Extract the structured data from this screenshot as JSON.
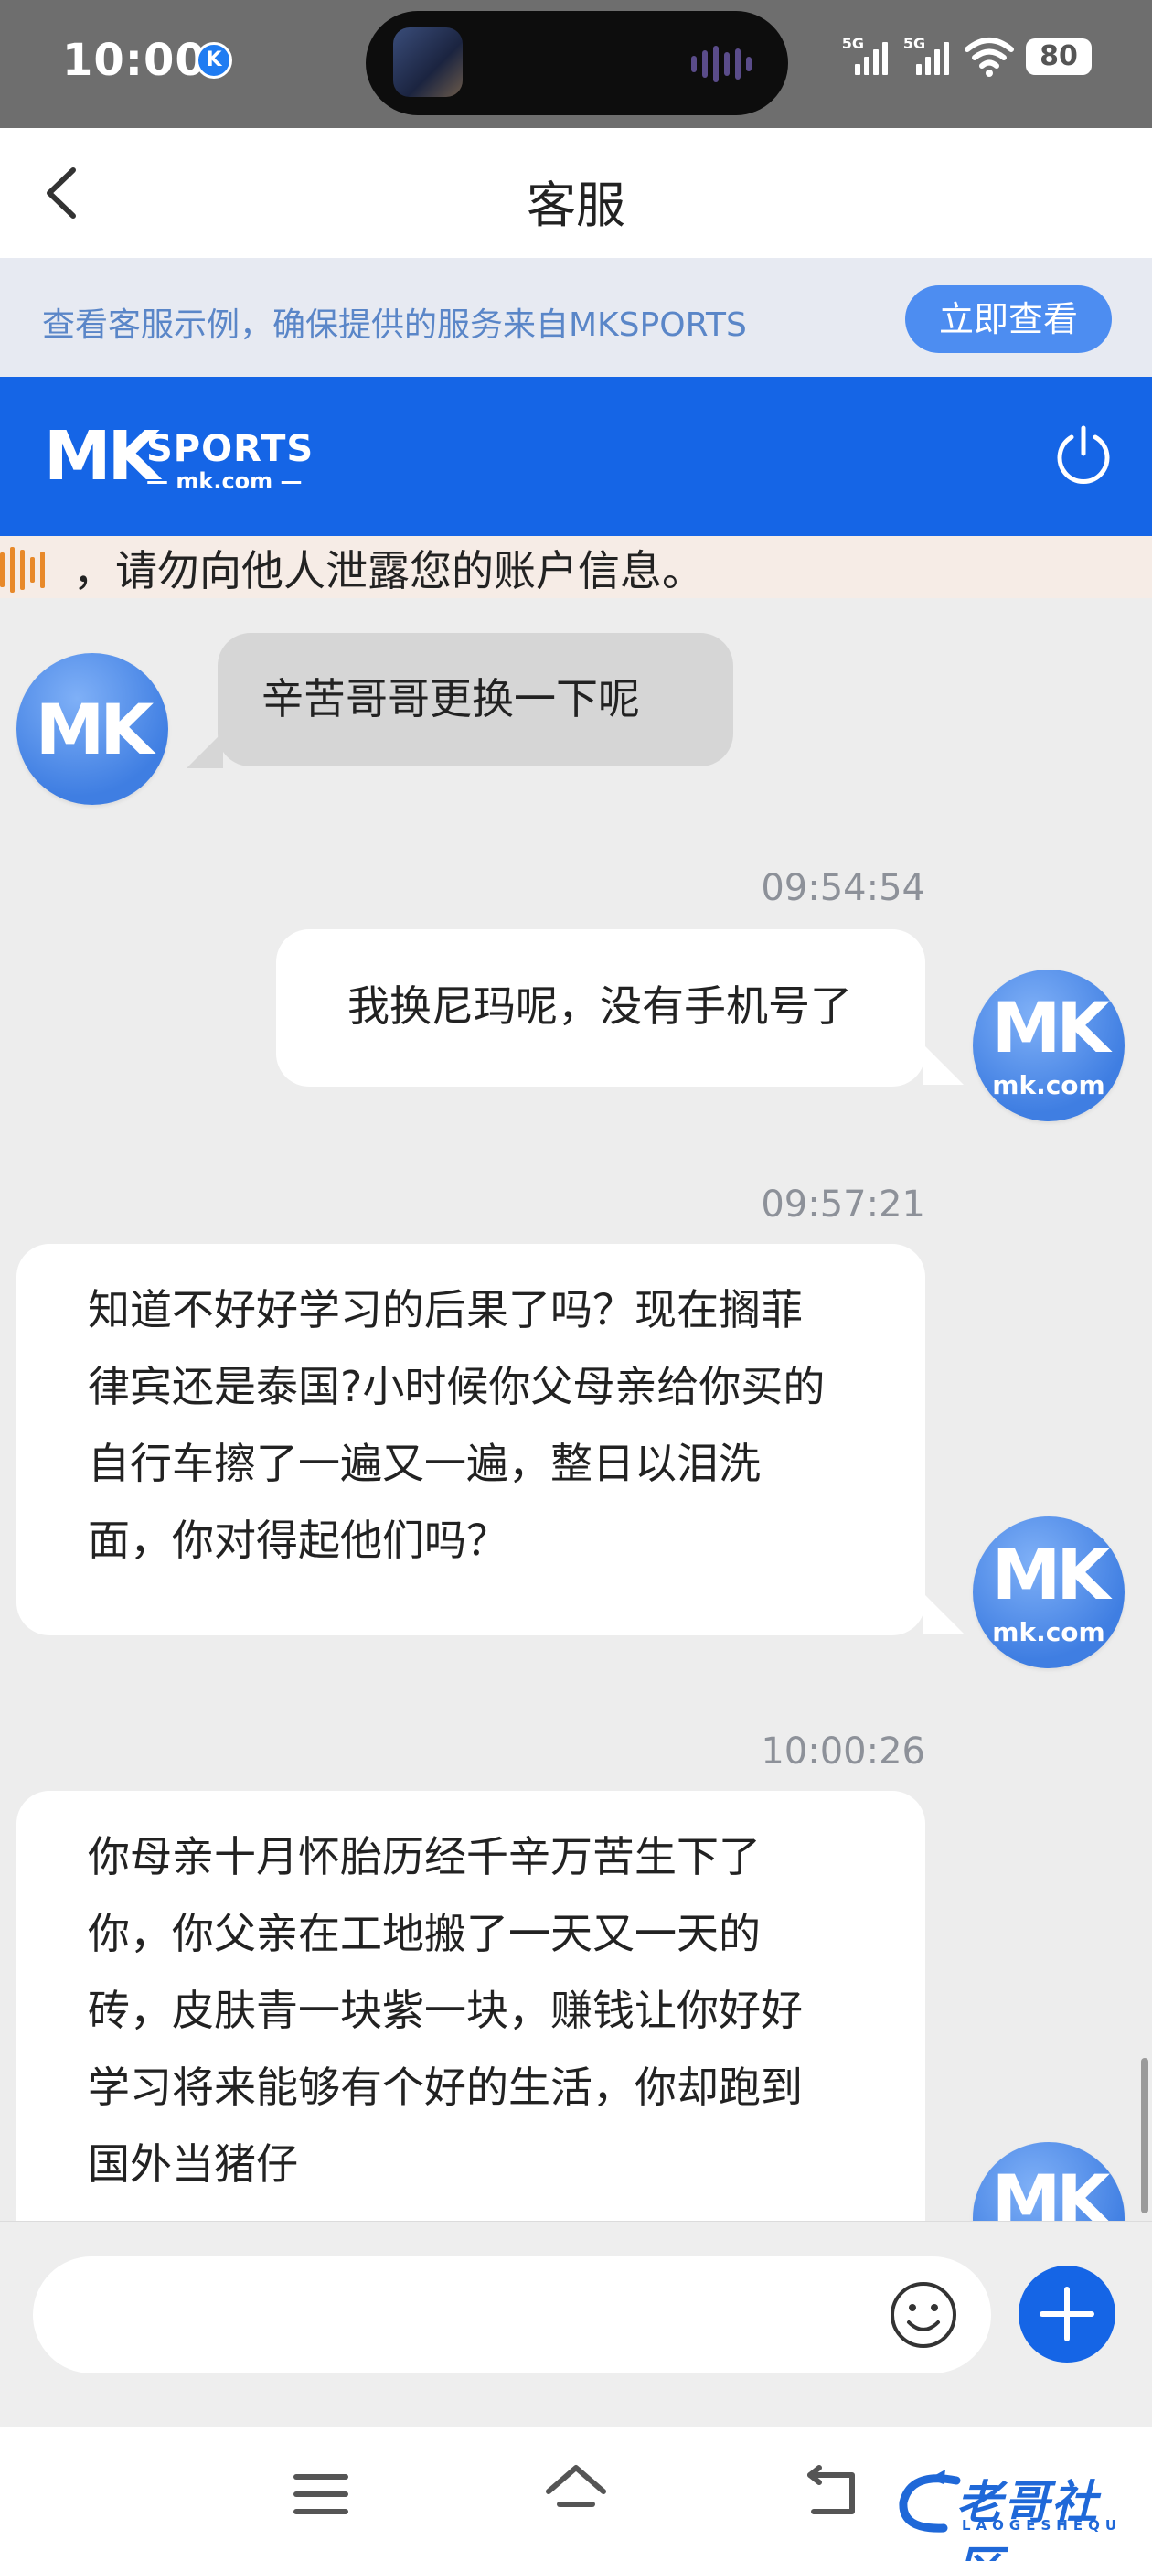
{
  "status_bar": {
    "time": "10:00",
    "k_badge": "K",
    "net1": "5G",
    "net2": "5G",
    "battery": "80"
  },
  "nav": {
    "title": "客服"
  },
  "notice": {
    "text": "查看客服示例，确保提供的服务来自MKSPORTS",
    "button": "立即查看"
  },
  "brand": {
    "mk": "MK",
    "sports": "SPORTS",
    "domain": "— mk.com —"
  },
  "ticker": {
    "text": "，请勿向他人泄露您的账户信息。"
  },
  "avatar": {
    "mk": "MK",
    "domain": "mk.com"
  },
  "messages": [
    {
      "side": "left",
      "text": "辛苦哥哥更换一下呢"
    },
    {
      "side": "right",
      "time": "09:54:54",
      "text": "我换尼玛呢，没有手机号了"
    },
    {
      "side": "right",
      "time": "09:57:21",
      "lines": [
        "知道不好好学习的后果了吗？现在搁菲",
        "律宾还是泰国?小时候你父母亲给你买的",
        "自行车擦了一遍又一遍，整日以泪洗",
        "面，你对得起他们吗？"
      ]
    },
    {
      "side": "right",
      "time": "10:00:26",
      "lines": [
        "你母亲十月怀胎历经千辛万苦生下了",
        "你，你父亲在工地搬了一天又一天的",
        "砖，皮肤青一块紫一块，赚钱让你好好",
        "学习将来能够有个好的生活，你却跑到",
        "国外当猪仔"
      ]
    }
  ],
  "watermark": {
    "text": "老哥社区",
    "sub": "LAOGESHEQU"
  },
  "colors": {
    "brand_blue": "#1565e6",
    "notice_bg": "#e7eaf2",
    "chat_bg": "#ededed"
  }
}
